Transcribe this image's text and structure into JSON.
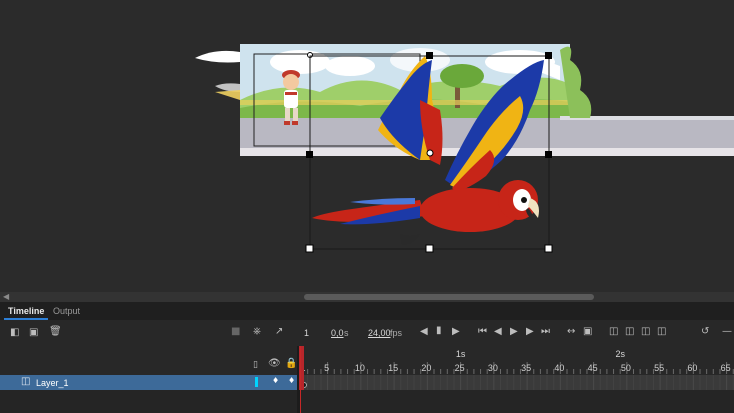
{
  "panel_tabs": [
    {
      "label": "Timeline",
      "active": true
    },
    {
      "label": "Output",
      "active": false
    }
  ],
  "toolbar": {
    "current_frame": "1",
    "time": "0,0",
    "time_unit": "s",
    "fps_value": "24,00",
    "fps_unit": "fps"
  },
  "ruler": {
    "second_markers": [
      {
        "label": "1s",
        "frame": 24
      },
      {
        "label": "2s",
        "frame": 48
      }
    ],
    "frame_labels": [
      "1",
      "5",
      "10",
      "15",
      "20",
      "25",
      "30",
      "35",
      "40",
      "45",
      "50",
      "55",
      "60",
      "65"
    ]
  },
  "layers": [
    {
      "name": "Layer_1",
      "color": "#00d4ff",
      "selected": true
    }
  ],
  "colors": {
    "accent": "#2d7fd6",
    "playhead": "#c62828",
    "layer_selected_bg": "#3d6a99",
    "stage_bg": "#2b2b2b"
  }
}
